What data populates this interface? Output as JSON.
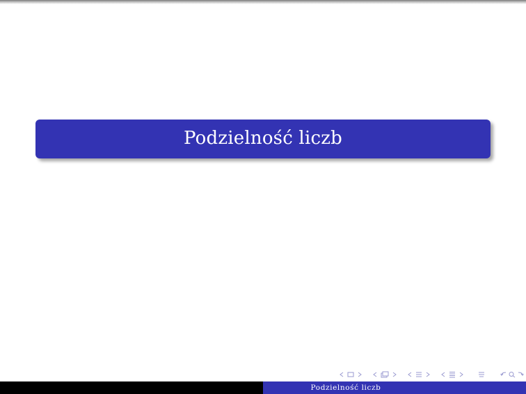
{
  "slide": {
    "title": "Podzielność liczb"
  },
  "footer": {
    "title": "Podzielność liczb"
  },
  "navigation": {
    "icons": [
      "nav-frame-prev-icon",
      "nav-frame-icon",
      "nav-frame-next-icon",
      "nav-subsection-prev-icon",
      "nav-subsection-icon",
      "nav-subsection-next-icon",
      "nav-section-prev-icon",
      "nav-section-icon",
      "nav-section-next-icon",
      "nav-section-list-prev-icon",
      "nav-section-list-icon",
      "nav-section-list-next-icon",
      "nav-align-icon",
      "nav-search-icon",
      "nav-back-icon"
    ]
  },
  "colors": {
    "accent": "#3333b3",
    "footer_left": "#000000",
    "nav_icons": "#9a9ad0"
  }
}
